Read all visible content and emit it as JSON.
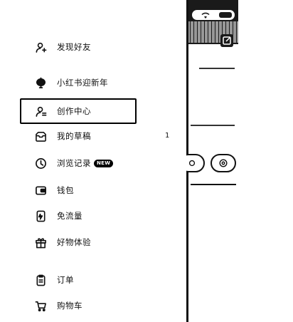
{
  "menu": {
    "items": [
      {
        "label": "发现好友",
        "icon": "add-friend-icon"
      },
      {
        "label": "小红书迎新年",
        "icon": "lantern-icon"
      },
      {
        "label": "创作中心",
        "icon": "creator-icon",
        "highlighted": true
      },
      {
        "label": "我的草稿",
        "icon": "drafts-icon",
        "count": "1"
      },
      {
        "label": "浏览记录",
        "icon": "history-icon",
        "badge": "NEW"
      },
      {
        "label": "钱包",
        "icon": "wallet-icon"
      },
      {
        "label": "免流量",
        "icon": "free-data-icon"
      },
      {
        "label": "好物体验",
        "icon": "gift-icon"
      },
      {
        "label": "订单",
        "icon": "orders-icon"
      },
      {
        "label": "购物车",
        "icon": "cart-icon"
      }
    ]
  },
  "background_screen": {
    "icons": [
      "wifi-icon",
      "battery-icon",
      "edit-icon",
      "settings-icon"
    ]
  }
}
